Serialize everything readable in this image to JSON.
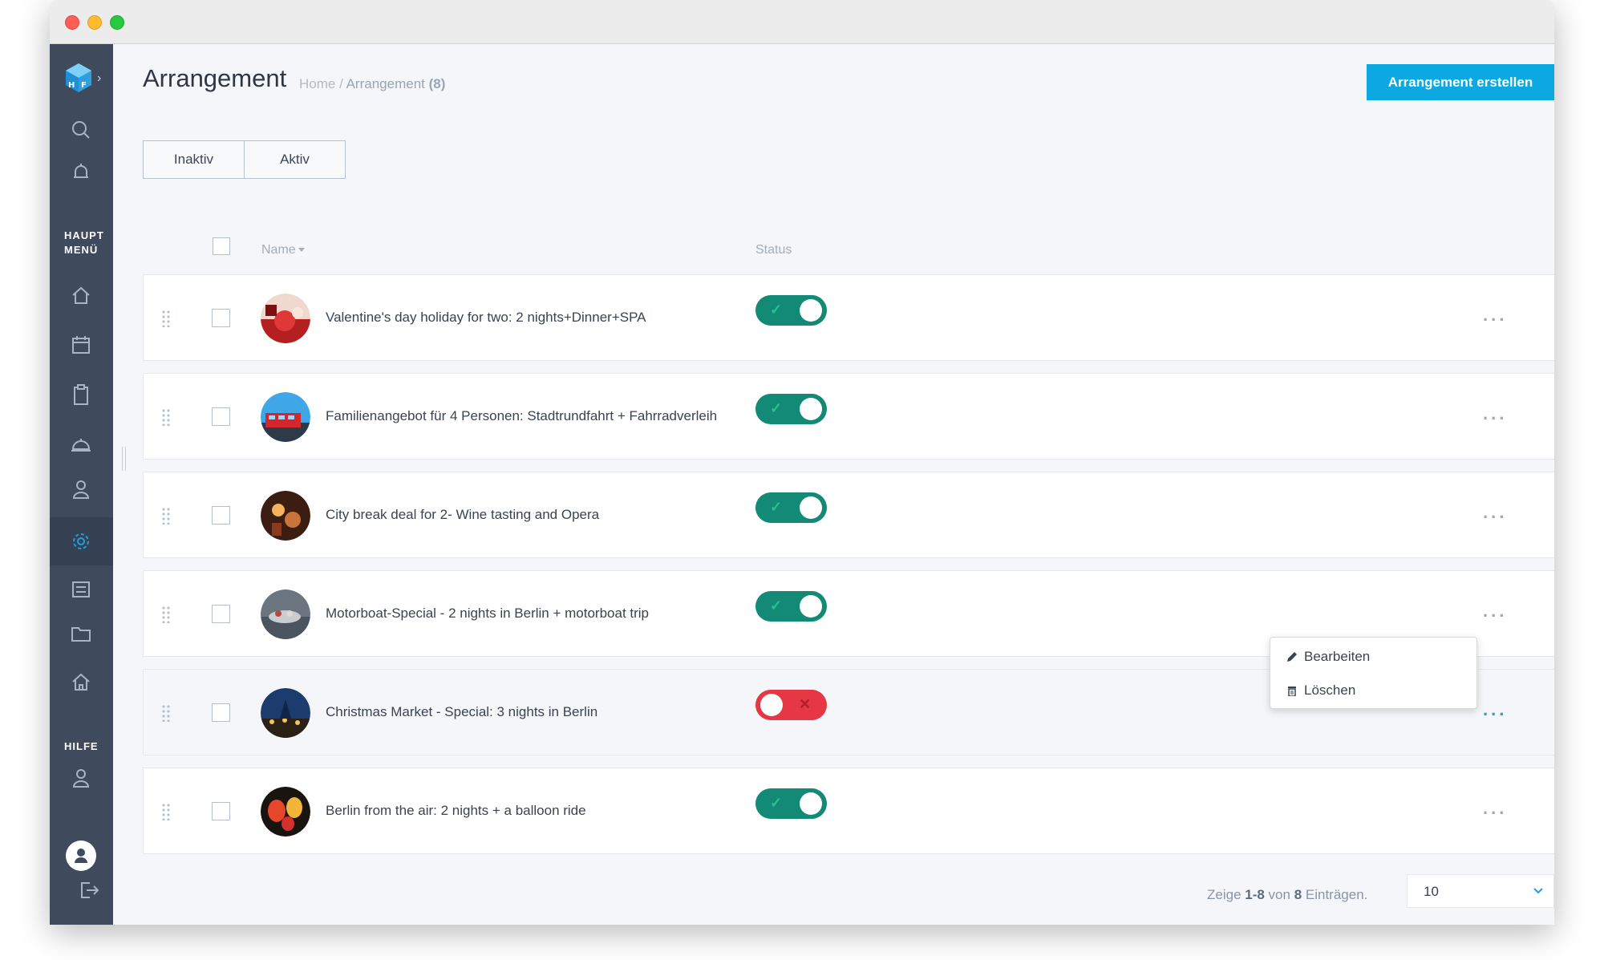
{
  "window": {
    "controls": [
      "close",
      "minimize",
      "maximize"
    ]
  },
  "sidebar": {
    "logo_icon": "hf-cube-logo-icon",
    "top_icons": [
      "search-icon",
      "bell-icon"
    ],
    "main_menu_label_line1": "HAUPT",
    "main_menu_label_line2": "MENÜ",
    "menu_icons": [
      "home-icon",
      "calendar-icon",
      "clipboard-icon",
      "service-bell-icon",
      "user-icon",
      "gear-icon",
      "list-icon",
      "folder-icon",
      "house-icon"
    ],
    "active_item": "gear-icon",
    "help_label": "HILFE",
    "help_icon": "user-icon",
    "bottom_icons": [
      "avatar-icon",
      "logout-icon"
    ]
  },
  "header": {
    "title": "Arrangement",
    "breadcrumb_home": "Home",
    "breadcrumb_separator": " / ",
    "breadcrumb_current": "Arrangement",
    "breadcrumb_count": "(8)",
    "create_button_label": "Arrangement erstellen"
  },
  "tabs": [
    {
      "label": "Inaktiv"
    },
    {
      "label": "Aktiv"
    }
  ],
  "table": {
    "columns": {
      "name": "Name",
      "status": "Status"
    },
    "rows": [
      {
        "title": "Valentine's day holiday for two: 2 nights+Dinner+SPA",
        "status": "on",
        "status_symbol": "✓"
      },
      {
        "title": "Familienangebot für 4 Personen: Stadtrundfahrt + Fahrradverleih",
        "status": "on",
        "status_symbol": "✓"
      },
      {
        "title": "City break deal for 2- Wine tasting and Opera",
        "status": "on",
        "status_symbol": "✓"
      },
      {
        "title": "Motorboat-Special - 2 nights in Berlin + motorboat trip",
        "status": "on",
        "status_symbol": "✓"
      },
      {
        "title": "Christmas Market - Special: 3 nights in Berlin",
        "status": "off",
        "status_symbol": "✕"
      },
      {
        "title": "Berlin from the air: 2 nights + a balloon ride",
        "status": "on",
        "status_symbol": "✓"
      }
    ],
    "more_label": "...",
    "row_icons": [
      "drag-handle-icon",
      "more-icon"
    ]
  },
  "context_menu": {
    "edit_label": "Bearbeiten",
    "edit_icon": "pencil-icon",
    "delete_label": "Löschen",
    "delete_icon": "trash-icon"
  },
  "footer": {
    "showing_prefix": "Zeige ",
    "showing_range": "1-8",
    "showing_middle": " von ",
    "showing_total": "8",
    "showing_suffix": " Einträgen.",
    "per_page_value": "10"
  },
  "colors": {
    "accent": "#0ca8e2",
    "sidebar": "#3f4b5d",
    "toggle_on": "#138a75",
    "toggle_off": "#e53844",
    "background": "#f4f6f9"
  }
}
